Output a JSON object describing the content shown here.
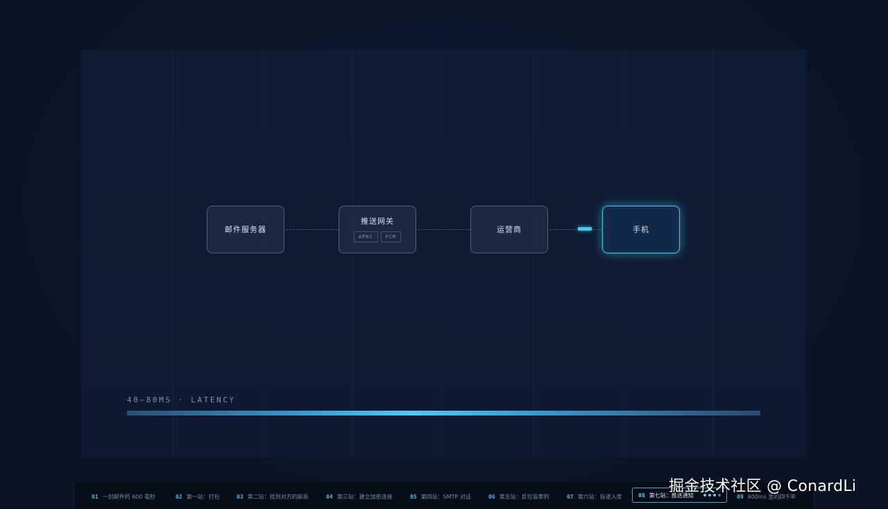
{
  "diagram": {
    "nodes": [
      {
        "label": "邮件服务器"
      },
      {
        "label": "推送网关",
        "chips": [
          "APNS",
          "FCM"
        ]
      },
      {
        "label": "运营商"
      },
      {
        "label": "手机"
      }
    ]
  },
  "latency": {
    "label": "40~80MS · LATENCY"
  },
  "nav": {
    "items": [
      {
        "num": "01",
        "label": "一封邮件的 600 毫秒"
      },
      {
        "num": "02",
        "label": "第一站：打包"
      },
      {
        "num": "03",
        "label": "第二站：找到对方的邮局"
      },
      {
        "num": "04",
        "label": "第三站：建立加密连接"
      },
      {
        "num": "05",
        "label": "第四站：SMTP 对话"
      },
      {
        "num": "06",
        "label": "第五站：反垃圾审判"
      },
      {
        "num": "07",
        "label": "第六站：投递入库"
      },
      {
        "num": "08",
        "label": "第七站：推送通知"
      },
      {
        "num": "09",
        "label": "600ms 里的四千年"
      }
    ],
    "current_index": 7
  },
  "watermark": "掘金技术社区 @ ConardLi",
  "colors": {
    "accent": "#52c4ee",
    "background": "#0a1424",
    "slide": "#0f1d34"
  }
}
